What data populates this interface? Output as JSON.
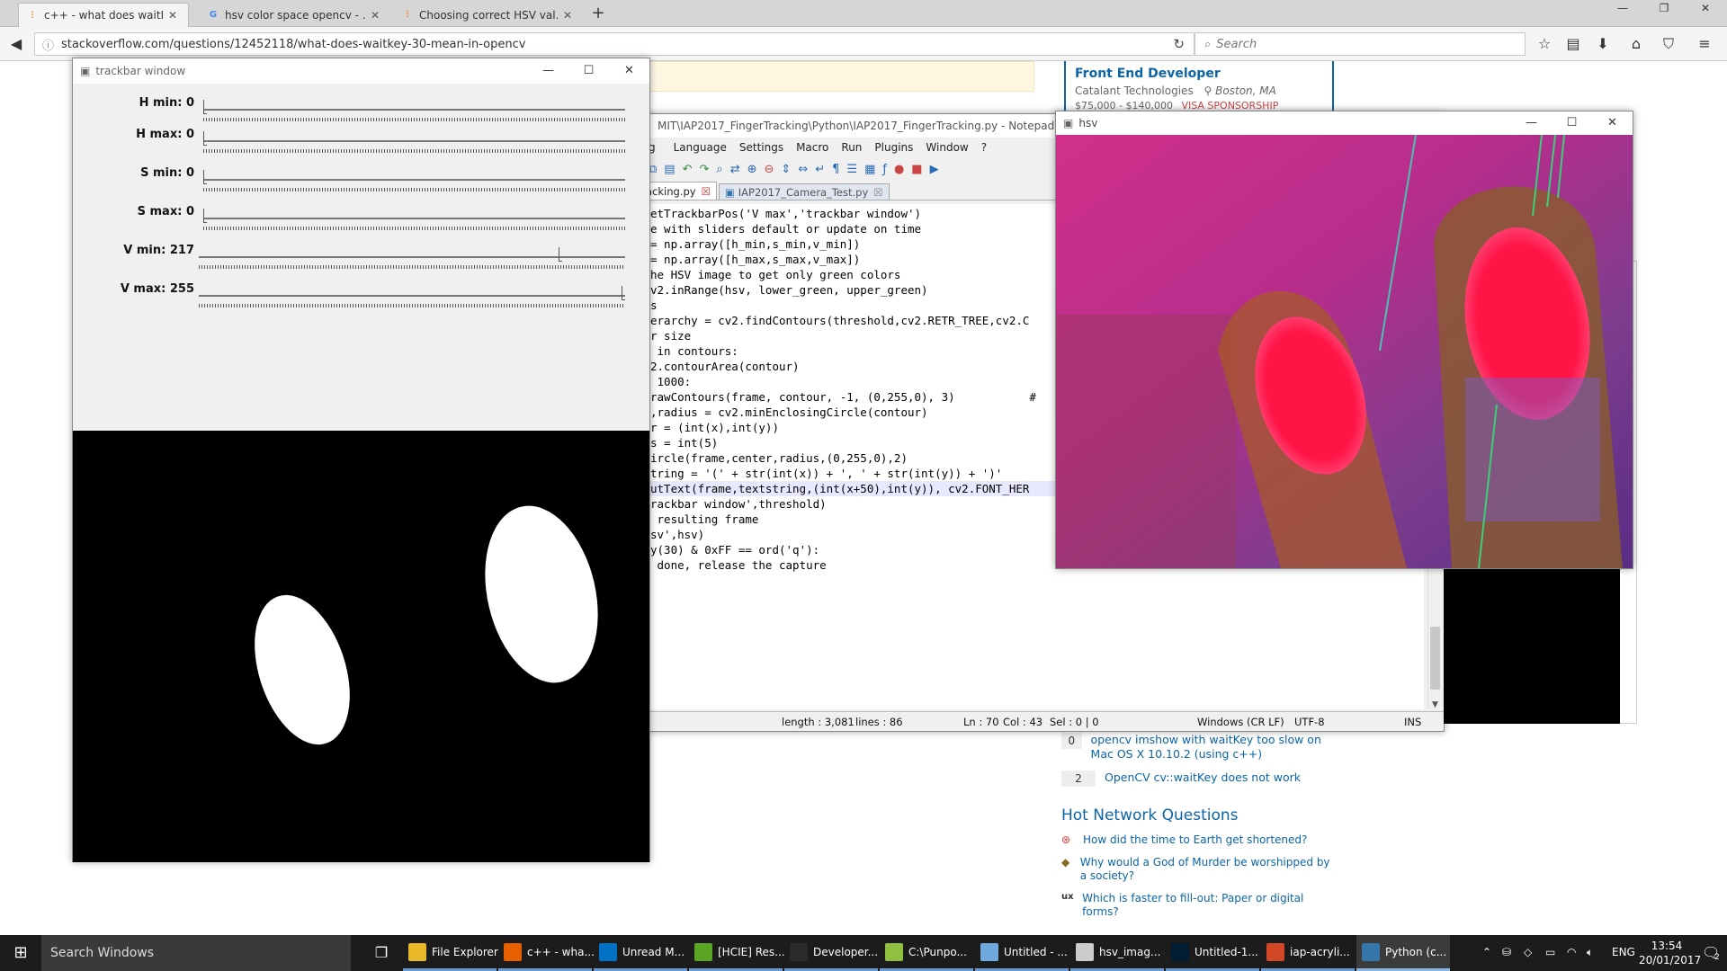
{
  "browser": {
    "tabs": [
      {
        "label": "c++ - what does waitKey (…",
        "icon": "stackoverflow-icon",
        "active": true
      },
      {
        "label": "hsv color space opencv - …",
        "icon": "google-icon",
        "active": false
      },
      {
        "label": "Choosing correct HSV val…",
        "icon": "stackoverflow-icon",
        "active": false
      }
    ],
    "url": "stackoverflow.com/questions/12452118/what-does-waitkey-30-mean-in-opencv",
    "search_placeholder": "Search"
  },
  "stackoverflow": {
    "job": {
      "title": "Front End Developer",
      "company": "Catalant Technologies",
      "location": "Boston, MA",
      "salary": "$75,000 - $140,000",
      "sponsorship": "VISA SPONSORSHIP"
    },
    "linked": [
      {
        "votes": "0",
        "text": "opencv imshow with waitKey too slow on Mac OS X 10.10.2 (using c++)"
      },
      {
        "votes": "2",
        "text": "OpenCV cv::waitKey does not work"
      }
    ],
    "hot_title": "Hot Network Questions",
    "hot": [
      {
        "text": "How did the time to Earth get shortened?",
        "icon": "worldbuilding-icon"
      },
      {
        "text": "Why would a God of Murder be worshipped by a society?",
        "icon": "rpg-icon"
      },
      {
        "text": "Which is faster to fill-out: Paper or digital forms?",
        "icon": "ux-icon",
        "badge": "ux"
      }
    ]
  },
  "trackbar_window": {
    "title": "trackbar window",
    "sliders": [
      {
        "label": "H min: 0",
        "value": 0,
        "max": 179
      },
      {
        "label": "H max: 0",
        "value": 0,
        "max": 179
      },
      {
        "label": "S min: 0",
        "value": 0,
        "max": 255
      },
      {
        "label": "S max: 0",
        "value": 0,
        "max": 255
      },
      {
        "label": "V min: 217",
        "value": 217,
        "max": 255
      },
      {
        "label": "V max: 255",
        "value": 255,
        "max": 255
      }
    ]
  },
  "notepad": {
    "title": "MIT\\IAP2017_FingerTracking\\Python\\IAP2017_FingerTracking.py - Notepad++",
    "menu": [
      "Language",
      "Settings",
      "Macro",
      "Run",
      "Plugins",
      "Window",
      "?"
    ],
    "menu_prefix": "g",
    "tabs": [
      {
        "label": "acking.py",
        "active": true
      },
      {
        "label": "IAP2017_Camera_Test.py",
        "active": false
      }
    ],
    "code_lines": [
      "etTrackbarPos('V max','trackbar window')",
      "",
      "e with sliders default or update on time",
      "= np.array([h_min,s_min,v_min])",
      "= np.array([h_max,s_max,v_max])",
      "",
      "he HSV image to get only green colors",
      "v2.inRange(hsv, lower_green, upper_green)",
      "",
      "s",
      "erarchy = cv2.findContours(threshold,cv2.RETR_TREE,cv2.C",
      "",
      "r size",
      " in contours:",
      "2.contourArea(contour)",
      " 1000:",
      "rawContours(frame, contour, -1, (0,255,0), 3)           #",
      ",radius = cv2.minEnclosingCircle(contour)",
      "r = (int(x),int(y))",
      "s = int(5)",
      "ircle(frame,center,radius,(0,255,0),2)",
      "tring = '(' + str(int(x)) + ', ' + str(int(y)) + ')'",
      "utText(frame,textstring,(int(x+50),int(y)), cv2.FONT_HER",
      "",
      "rackbar window',threshold)",
      "",
      " resulting frame",
      "sv',hsv)",
      "",
      "y(30) & 0xFF == ord('q'):",
      "",
      "",
      " done, release the capture"
    ],
    "status": {
      "length": "length : 3,081",
      "lines": "lines : 86",
      "ln": "Ln : 70",
      "col": "Col : 43",
      "sel": "Sel : 0 | 0",
      "eol": "Windows (CR LF)",
      "encoding": "UTF-8",
      "mode": "INS"
    }
  },
  "hsv_window": {
    "title": "hsv"
  },
  "taskbar": {
    "search_placeholder": "Search Windows",
    "items": [
      {
        "label": "File Explorer",
        "icon": "folder-icon",
        "color": "#e8b829",
        "state": "open"
      },
      {
        "label": "c++ - wha...",
        "icon": "firefox-icon",
        "color": "#e66000",
        "state": "open"
      },
      {
        "label": "Unread M...",
        "icon": "outlook-icon",
        "color": "#0072c6",
        "state": "open"
      },
      {
        "label": "[HCIE] Res...",
        "icon": "evernote-icon",
        "color": "#5ba525",
        "state": "open"
      },
      {
        "label": "Developer...",
        "icon": "terminal-icon",
        "color": "#2b2b2b",
        "state": "open"
      },
      {
        "label": "C:\\Punpo...",
        "icon": "notepadpp-icon",
        "color": "#90c040",
        "state": "open"
      },
      {
        "label": "Untitled - ...",
        "icon": "notepad-icon",
        "color": "#6fa8dc",
        "state": "open"
      },
      {
        "label": "hsv_imag...",
        "icon": "paint-icon",
        "color": "#cccccc",
        "state": "open"
      },
      {
        "label": "Untitled-1...",
        "icon": "photoshop-icon",
        "color": "#001d34",
        "state": "open"
      },
      {
        "label": "iap-acryli...",
        "icon": "powerpoint-icon",
        "color": "#d24726",
        "state": "open"
      },
      {
        "label": "Python (c...",
        "icon": "python-icon",
        "color": "#3776ab",
        "state": "current"
      }
    ],
    "tray": {
      "lang": "ENG",
      "time": "13:54",
      "date": "20/01/2017",
      "notifications": "2"
    }
  }
}
